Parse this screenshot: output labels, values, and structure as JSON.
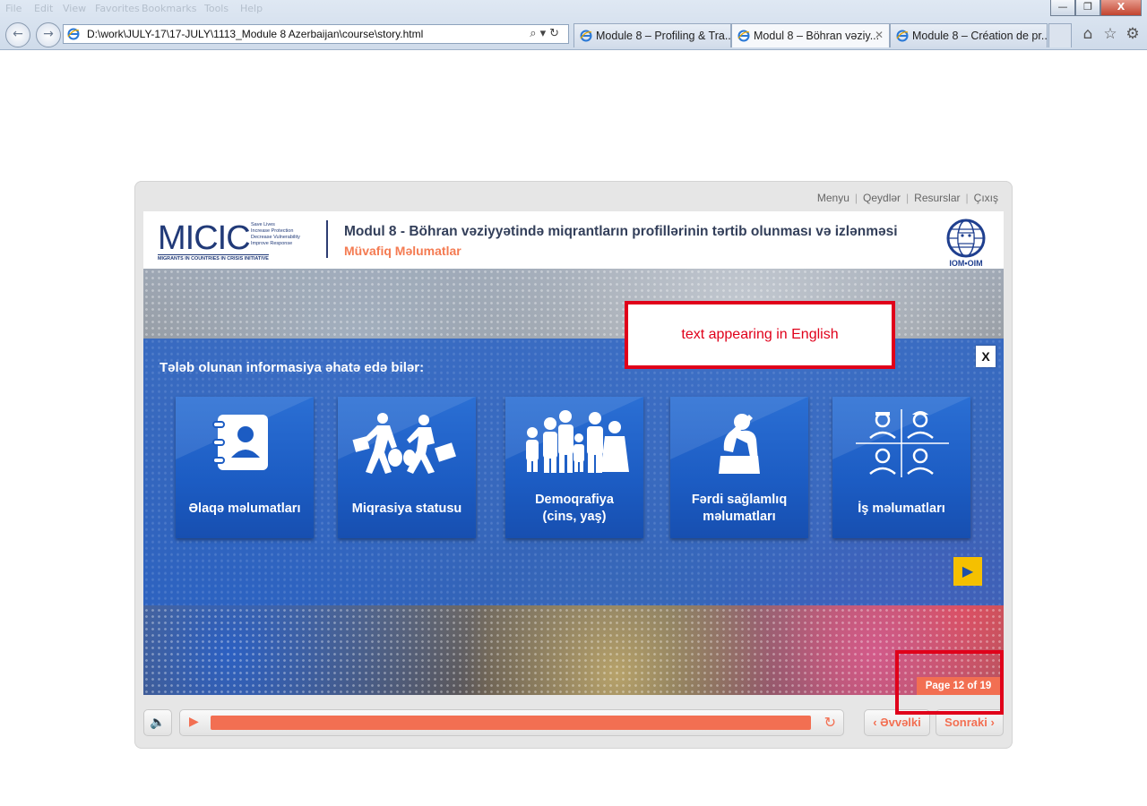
{
  "browser": {
    "menu_items": [
      "File",
      "Edit",
      "View",
      "Favorites",
      "Bookmarks",
      "Tools",
      "Help"
    ],
    "address": "D:\\work\\JULY-17\\17-JULY\\1113_Module 8 Azerbaijan\\course\\story.html",
    "tabs": [
      {
        "label": "Module 8 – Profiling & Tra...",
        "active": false
      },
      {
        "label": "Modul 8 – Böhran vəziy...",
        "active": true
      },
      {
        "label": "Module 8 – Création de pr...",
        "active": false
      }
    ],
    "window_buttons": {
      "minimize": "—",
      "restore": "❐",
      "close": "X"
    }
  },
  "player": {
    "topnav": {
      "menu": "Menyu",
      "notes": "Qeydlər",
      "resources": "Resurslar",
      "exit": "Çıxış"
    },
    "header": {
      "logo_text": "MICIC",
      "logo_taglines": [
        "Save Lives",
        "Increase Protection",
        "Decrease Vulnerability",
        "Improve Response"
      ],
      "logo_footer": "MIGRANTS IN COUNTRIES IN CRISIS INITIATIVE",
      "title": "Modul 8 - Böhran vəziyyətində miqrantların profillərinin tərtib olunması və izlənməsi",
      "subtitle": "Müvafiq Məlumatlar",
      "iom_label": "IOM•OIM"
    },
    "overlay": {
      "title": "Tələb olunan informasiya əhatə edə bilər:",
      "close_label": "X",
      "cards": [
        {
          "label": "Əlaqə məlumatları",
          "icon": "contact-book-icon"
        },
        {
          "label": "Miqrasiya statusu",
          "icon": "migrants-walking-icon"
        },
        {
          "label": "Demoqrafiya\n(cins, yaş)",
          "icon": "family-group-icon"
        },
        {
          "label": "Fərdi sağlamlıq\nməlumatları",
          "icon": "distressed-person-icon"
        },
        {
          "label": "İş məlumatları",
          "icon": "workers-grid-icon"
        }
      ]
    },
    "annotation_text": "text appearing in English",
    "page_indicator": "Page 12 of 19",
    "playbar": {
      "progress_fraction": 1.0,
      "prev_label": "Əvvəlki",
      "next_label": "Sonraki"
    }
  },
  "colors": {
    "accent": "#f26f52",
    "overlay_blue": "#2b63c4",
    "annotation_red": "#e0001a",
    "next_arrow": "#f5c000"
  }
}
